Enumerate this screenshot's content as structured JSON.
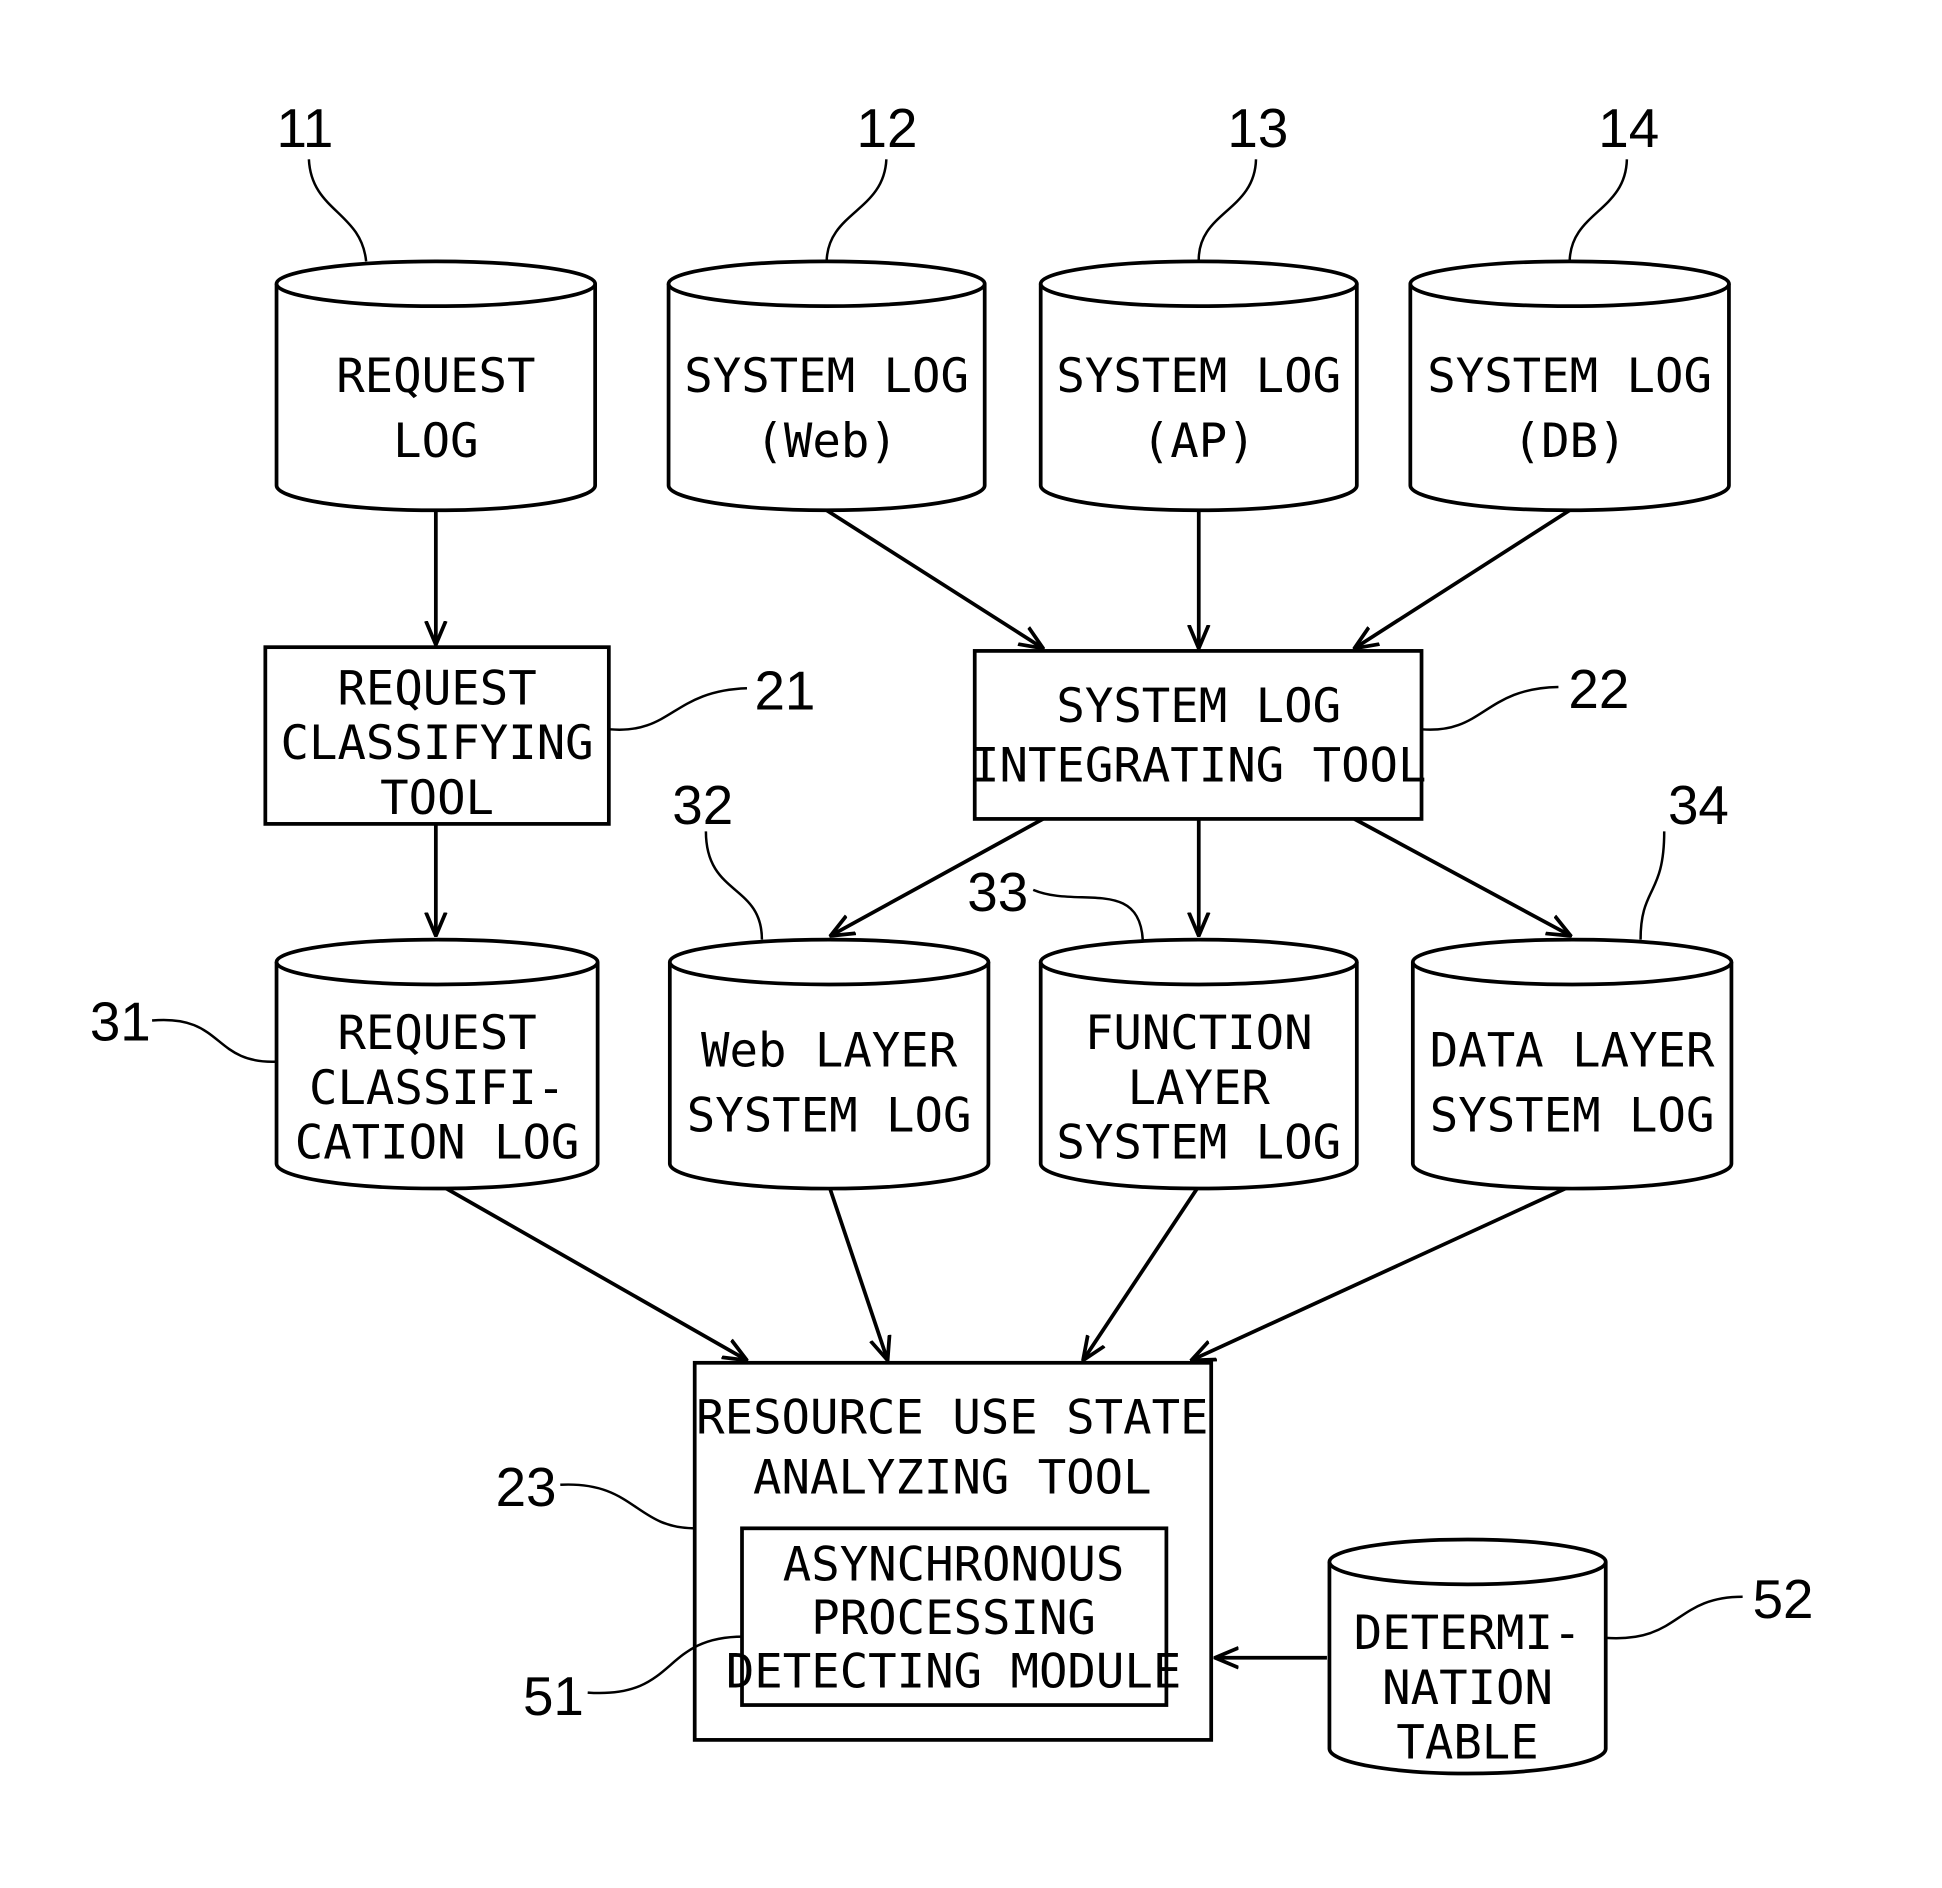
{
  "diagram": {
    "databases": {
      "request_log": {
        "ref": "11",
        "lines": [
          "REQUEST",
          "LOG"
        ]
      },
      "system_log_web": {
        "ref": "12",
        "lines": [
          "SYSTEM LOG",
          "(Web)"
        ]
      },
      "system_log_ap": {
        "ref": "13",
        "lines": [
          "SYSTEM LOG",
          "(AP)"
        ]
      },
      "system_log_db": {
        "ref": "14",
        "lines": [
          "SYSTEM LOG",
          "(DB)"
        ]
      },
      "request_classification_log": {
        "ref": "31",
        "lines": [
          "REQUEST",
          "CLASSIFI-",
          "CATION LOG"
        ]
      },
      "web_layer_log": {
        "ref": "32",
        "lines": [
          "Web LAYER",
          "SYSTEM LOG"
        ]
      },
      "function_layer_log": {
        "ref": "33",
        "lines": [
          "FUNCTION",
          "LAYER",
          "SYSTEM LOG"
        ]
      },
      "data_layer_log": {
        "ref": "34",
        "lines": [
          "DATA LAYER",
          "SYSTEM LOG"
        ]
      },
      "determination_table": {
        "ref": "52",
        "lines": [
          "DETERMI-",
          "NATION",
          "TABLE"
        ]
      }
    },
    "tools": {
      "request_classifying_tool": {
        "ref": "21",
        "lines": [
          "REQUEST",
          "CLASSIFYING",
          "TOOL"
        ]
      },
      "system_log_integrating_tool": {
        "ref": "22",
        "lines": [
          "SYSTEM LOG",
          "INTEGRATING TOOL"
        ]
      },
      "resource_use_state_analyzing_tool": {
        "ref": "23",
        "lines": [
          "RESOURCE USE STATE",
          "ANALYZING TOOL"
        ]
      },
      "asynchronous_processing_detecting_module": {
        "ref": "51",
        "lines": [
          "ASYNCHRONOUS",
          "PROCESSING",
          "DETECTING MODULE"
        ]
      }
    },
    "edges": [
      [
        "request_log",
        "request_classifying_tool"
      ],
      [
        "request_classifying_tool",
        "request_classification_log"
      ],
      [
        "system_log_web",
        "system_log_integrating_tool"
      ],
      [
        "system_log_ap",
        "system_log_integrating_tool"
      ],
      [
        "system_log_db",
        "system_log_integrating_tool"
      ],
      [
        "system_log_integrating_tool",
        "web_layer_log"
      ],
      [
        "system_log_integrating_tool",
        "function_layer_log"
      ],
      [
        "system_log_integrating_tool",
        "data_layer_log"
      ],
      [
        "request_classification_log",
        "resource_use_state_analyzing_tool"
      ],
      [
        "web_layer_log",
        "resource_use_state_analyzing_tool"
      ],
      [
        "function_layer_log",
        "resource_use_state_analyzing_tool"
      ],
      [
        "data_layer_log",
        "resource_use_state_analyzing_tool"
      ],
      [
        "determination_table",
        "asynchronous_processing_detecting_module"
      ]
    ]
  }
}
